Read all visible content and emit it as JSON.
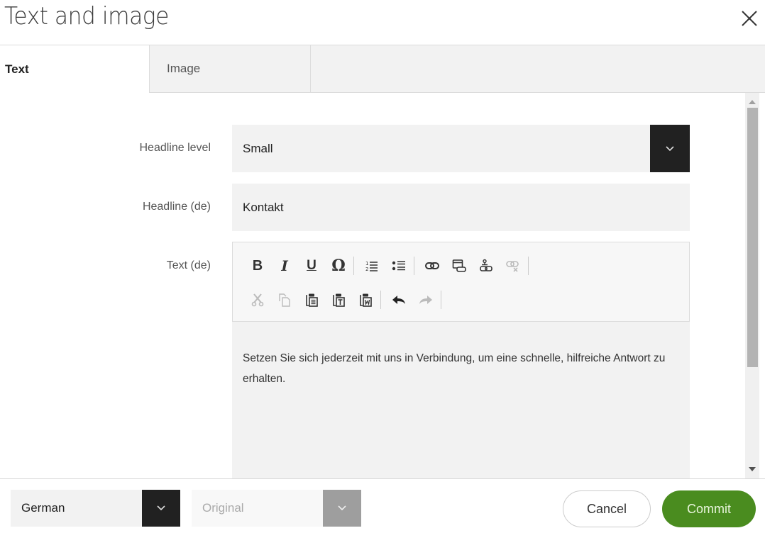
{
  "dialog": {
    "title": "Text and image",
    "close_icon": "close-icon"
  },
  "tabs": [
    {
      "label": "Text",
      "active": true
    },
    {
      "label": "Image",
      "active": false
    }
  ],
  "form": {
    "headline_level": {
      "label": "Headline level",
      "value": "Small"
    },
    "headline": {
      "label": "Headline (de)",
      "value": "Kontakt"
    },
    "text": {
      "label": "Text (de)",
      "content": "Setzen Sie sich jederzeit mit uns in Verbindung, um eine schnelle, hilfreiche Antwort zu erhalten."
    }
  },
  "toolbar": {
    "row1": [
      {
        "icon": "bold-icon",
        "glyph": "B",
        "enabled": true
      },
      {
        "icon": "italic-icon",
        "glyph": "I",
        "enabled": true
      },
      {
        "icon": "underline-icon",
        "glyph": "U",
        "enabled": true
      },
      {
        "icon": "special-char-icon",
        "glyph": "Ω",
        "enabled": true
      },
      {
        "icon": "numbered-list-icon",
        "enabled": true
      },
      {
        "icon": "bulleted-list-icon",
        "enabled": true
      },
      {
        "icon": "link-icon",
        "enabled": true
      },
      {
        "icon": "link-external-icon",
        "enabled": true
      },
      {
        "icon": "link-internal-icon",
        "enabled": true
      },
      {
        "icon": "unlink-icon",
        "enabled": false
      }
    ],
    "row2": [
      {
        "icon": "cut-icon",
        "enabled": false
      },
      {
        "icon": "copy-icon",
        "enabled": false
      },
      {
        "icon": "paste-icon",
        "enabled": true
      },
      {
        "icon": "paste-text-icon",
        "enabled": true
      },
      {
        "icon": "paste-word-icon",
        "enabled": true
      },
      {
        "icon": "undo-icon",
        "enabled": true
      },
      {
        "icon": "redo-icon",
        "enabled": false
      }
    ]
  },
  "footer": {
    "language": "German",
    "version": "Original",
    "cancel_label": "Cancel",
    "commit_label": "Commit"
  },
  "colors": {
    "accent": "#4a8c1f",
    "select_button": "#212121",
    "disabled_select_button": "#9e9e9e",
    "field_background": "#f2f2f2"
  }
}
